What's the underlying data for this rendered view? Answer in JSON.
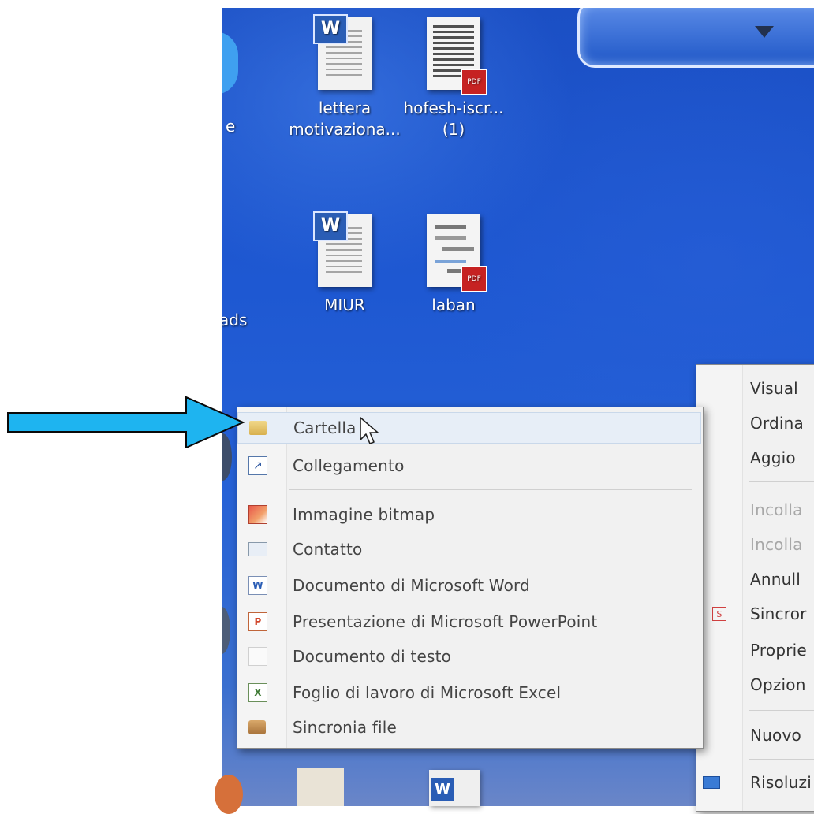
{
  "desktop": {
    "icons": [
      {
        "label": "lettera\nmotivaziona...",
        "type": "word"
      },
      {
        "label": "hofesh-iscr...\n(1)",
        "type": "pdf"
      },
      {
        "label": "MIUR",
        "type": "word"
      },
      {
        "label": "laban",
        "type": "pdf"
      }
    ],
    "partial_labels": [
      "e",
      "ads"
    ],
    "word_badge": "W",
    "pdf_badge": "PDF"
  },
  "new_submenu": {
    "items": [
      {
        "label": "Cartella",
        "icon": "folder-icon"
      },
      {
        "label": "Collegamento",
        "icon": "shortcut-icon"
      },
      {
        "label": "Immagine bitmap",
        "icon": "bitmap-icon"
      },
      {
        "label": "Contatto",
        "icon": "contact-icon"
      },
      {
        "label": "Documento di Microsoft Word",
        "icon": "word-doc-icon"
      },
      {
        "label": "Presentazione di Microsoft PowerPoint",
        "icon": "powerpoint-icon"
      },
      {
        "label": "Documento di testo",
        "icon": "text-doc-icon"
      },
      {
        "label": "Foglio di lavoro di Microsoft Excel",
        "icon": "excel-icon"
      },
      {
        "label": "Sincronia file",
        "icon": "briefcase-icon"
      }
    ]
  },
  "context_menu": {
    "items": [
      {
        "label": "Visual"
      },
      {
        "label": "Ordina"
      },
      {
        "label": "Aggio"
      },
      {
        "label": "Incolla"
      },
      {
        "label": "Incolla"
      },
      {
        "label": "Annull"
      },
      {
        "label": "Sincror"
      },
      {
        "label": "Proprie"
      },
      {
        "label": "Opzion"
      },
      {
        "label": "Nuovo"
      },
      {
        "label": "Risoluzi"
      }
    ]
  },
  "colors": {
    "callout_arrow": "#1eb4f0",
    "desktop_blue": "#1e58d2",
    "menu_bg": "#f1f1f1",
    "hover": "#e7eef7"
  }
}
